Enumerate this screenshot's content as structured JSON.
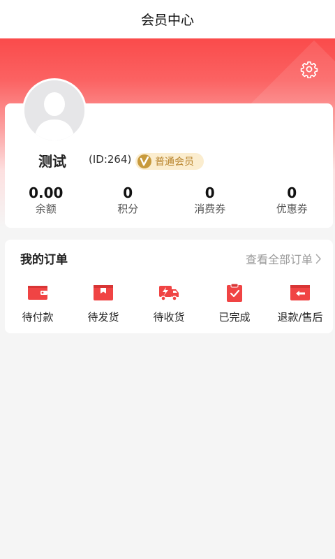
{
  "header": {
    "title": "会员中心"
  },
  "profile": {
    "name": "测试",
    "id_text": "(ID:264)",
    "level": "普通会员"
  },
  "stats": [
    {
      "value": "0.00",
      "label": "余额"
    },
    {
      "value": "0",
      "label": "积分"
    },
    {
      "value": "0",
      "label": "消费券"
    },
    {
      "value": "0",
      "label": "优惠券"
    }
  ],
  "orders": {
    "title": "我的订单",
    "view_all": "查看全部订单",
    "items": [
      {
        "label": "待付款",
        "icon": "wallet-icon"
      },
      {
        "label": "待发货",
        "icon": "box-icon"
      },
      {
        "label": "待收货",
        "icon": "truck-icon"
      },
      {
        "label": "已完成",
        "icon": "clipboard-check-icon"
      },
      {
        "label": "退款/售后",
        "icon": "refund-icon"
      }
    ]
  },
  "colors": {
    "accent": "#f04444",
    "badge_bg": "#fbedcf",
    "badge_text": "#b9852e"
  }
}
